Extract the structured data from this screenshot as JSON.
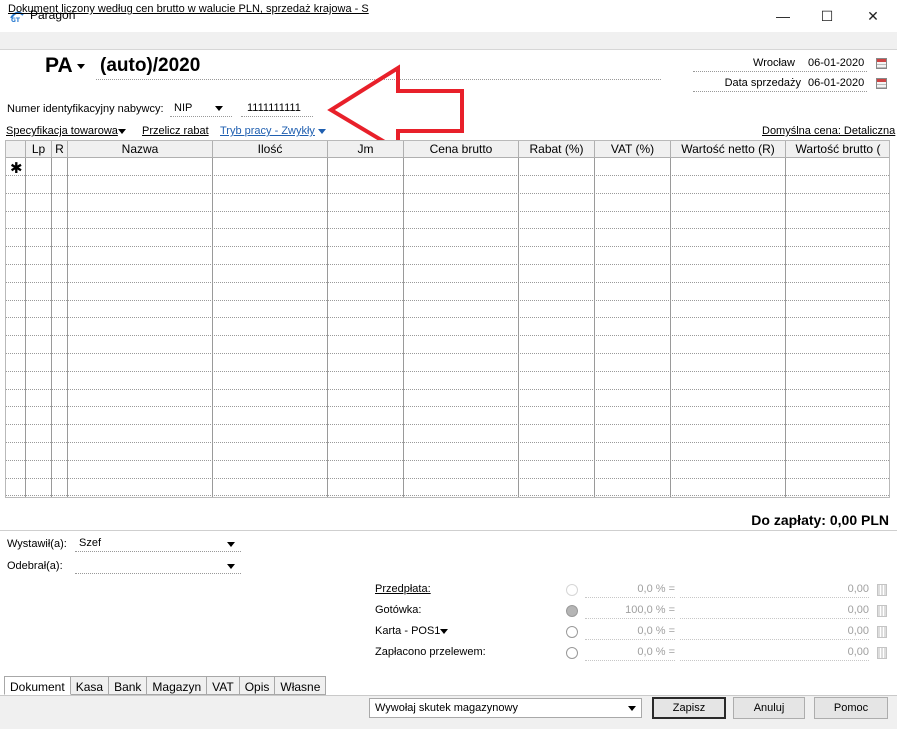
{
  "window": {
    "title": "Paragon",
    "minimize_glyph": "—",
    "maximize_glyph": "☐",
    "close_glyph": "✕"
  },
  "info_bar": {
    "text": "Dokument liczony według cen brutto w walucie PLN, sprzedaż krajowa - S"
  },
  "document": {
    "prefix": "PA",
    "number": "(auto)/2020"
  },
  "header": {
    "place_value": "Wrocław",
    "place_date": "06-01-2020",
    "sale_date_label": "Data sprzedaży",
    "sale_date": "06-01-2020"
  },
  "buyer": {
    "label": "Numer identyfikacyjny nabywcy:",
    "id_type": "NIP",
    "id_value": "1111111111"
  },
  "links": {
    "specification": "Specyfikacja towarowa",
    "recalc_discount": "Przelicz rabat",
    "work_mode": "Tryb pracy - Zwykły",
    "default_price": "Domyślna cena: Detaliczna"
  },
  "grid": {
    "columns": [
      "",
      "Lp",
      "R",
      "Nazwa",
      "Ilość",
      "Jm",
      "Cena brutto",
      "Rabat (%)",
      "VAT (%)",
      "Wartość netto (R)",
      "Wartość brutto ("
    ],
    "new_row_marker": "✱"
  },
  "total": {
    "text": "Do zapłaty: 0,00 PLN"
  },
  "issued": {
    "label": "Wystawił(a):",
    "value": "Szef"
  },
  "received": {
    "label": "Odebrał(a):",
    "value": ""
  },
  "payments": [
    {
      "label": "Przedpłata:",
      "percent": "0,0 % =",
      "amount": "0,00",
      "checked": false,
      "dim": true,
      "underline": true,
      "caret": false
    },
    {
      "label": "Gotówka:",
      "percent": "100,0 % =",
      "amount": "0,00",
      "checked": true,
      "dim": false,
      "underline": false,
      "caret": false
    },
    {
      "label": "Karta - POS1",
      "percent": "0,0 % =",
      "amount": "0,00",
      "checked": false,
      "dim": false,
      "underline": false,
      "caret": true
    },
    {
      "label": "Zapłacono przelewem:",
      "percent": "0,0 % =",
      "amount": "0,00",
      "checked": false,
      "dim": false,
      "underline": false,
      "caret": false
    }
  ],
  "tabs": [
    "Dokument",
    "Kasa",
    "Bank",
    "Magazyn",
    "VAT",
    "Opis",
    "Własne"
  ],
  "footer": {
    "action": "Wywołaj skutek magazynowy",
    "save": "Zapisz",
    "cancel": "Anuluj",
    "help": "Pomoc"
  },
  "colors": {
    "arrow": "#e8202a",
    "link": "#1f5fb0"
  }
}
